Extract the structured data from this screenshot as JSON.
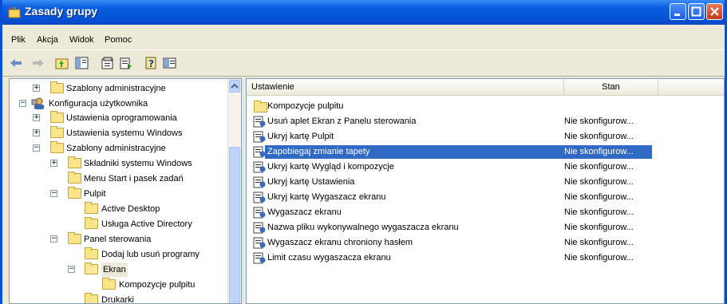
{
  "window": {
    "title": "Zasady grupy",
    "colors": {
      "titlebar": "#0a5fe0",
      "selection": "#316ac5",
      "folder": "#fbe58a"
    }
  },
  "menu": [
    "Plik",
    "Akcja",
    "Widok",
    "Pomoc"
  ],
  "toolbar": [
    "back-arrow-icon",
    "forward-arrow-icon",
    "up-folder-icon",
    "show-hide-tree-icon",
    "properties-icon",
    "export-list-icon",
    "help-icon",
    "console-view-icon"
  ],
  "tree": [
    {
      "label": "Szablony administracyjne",
      "expander": "+"
    },
    {
      "label": "Konfiguracja użytkownika",
      "expander": "−"
    },
    {
      "label": "Ustawienia oprogramowania",
      "expander": "+"
    },
    {
      "label": "Ustawienia systemu Windows",
      "expander": "+"
    },
    {
      "label": "Szablony administracyjne",
      "expander": "−"
    },
    {
      "label": "Składniki systemu Windows",
      "expander": "+"
    },
    {
      "label": "Menu Start i pasek zadań",
      "expander": ""
    },
    {
      "label": "Pulpit",
      "expander": "−"
    },
    {
      "label": "Active Desktop",
      "expander": ""
    },
    {
      "label": "Usługa Active Directory",
      "expander": ""
    },
    {
      "label": "Panel sterowania",
      "expander": "−"
    },
    {
      "label": "Dodaj lub usuń programy",
      "expander": ""
    },
    {
      "label": "Ekran",
      "expander": "−"
    },
    {
      "label": "Kompozycje pulpitu",
      "expander": ""
    },
    {
      "label": "Drukarki",
      "expander": ""
    }
  ],
  "list": {
    "columns": [
      "Ustawienie",
      "Stan"
    ],
    "rows": [
      {
        "name": "Kompozycje pulpitu",
        "state": ""
      },
      {
        "name": "Usuń aplet Ekran z Panelu sterowania",
        "state": "Nie skonfigurow..."
      },
      {
        "name": "Ukryj kartę Pulpit",
        "state": "Nie skonfigurow..."
      },
      {
        "name": "Zapobiegaj zmianie tapety",
        "state": "Nie skonfigurow..."
      },
      {
        "name": "Ukryj kartę Wygląd i kompozycje",
        "state": "Nie skonfigurow..."
      },
      {
        "name": "Ukryj kartę Ustawienia",
        "state": "Nie skonfigurow..."
      },
      {
        "name": "Ukryj kartę Wygaszacz ekranu",
        "state": "Nie skonfigurow..."
      },
      {
        "name": "Wygaszacz ekranu",
        "state": "Nie skonfigurow..."
      },
      {
        "name": "Nazwa pliku wykonywalnego wygaszacza ekranu",
        "state": "Nie skonfigurow..."
      },
      {
        "name": "Wygaszacz ekranu chroniony hasłem",
        "state": "Nie skonfigurow..."
      },
      {
        "name": "Limit czasu wygaszacza ekranu",
        "state": "Nie skonfigurow..."
      }
    ]
  }
}
